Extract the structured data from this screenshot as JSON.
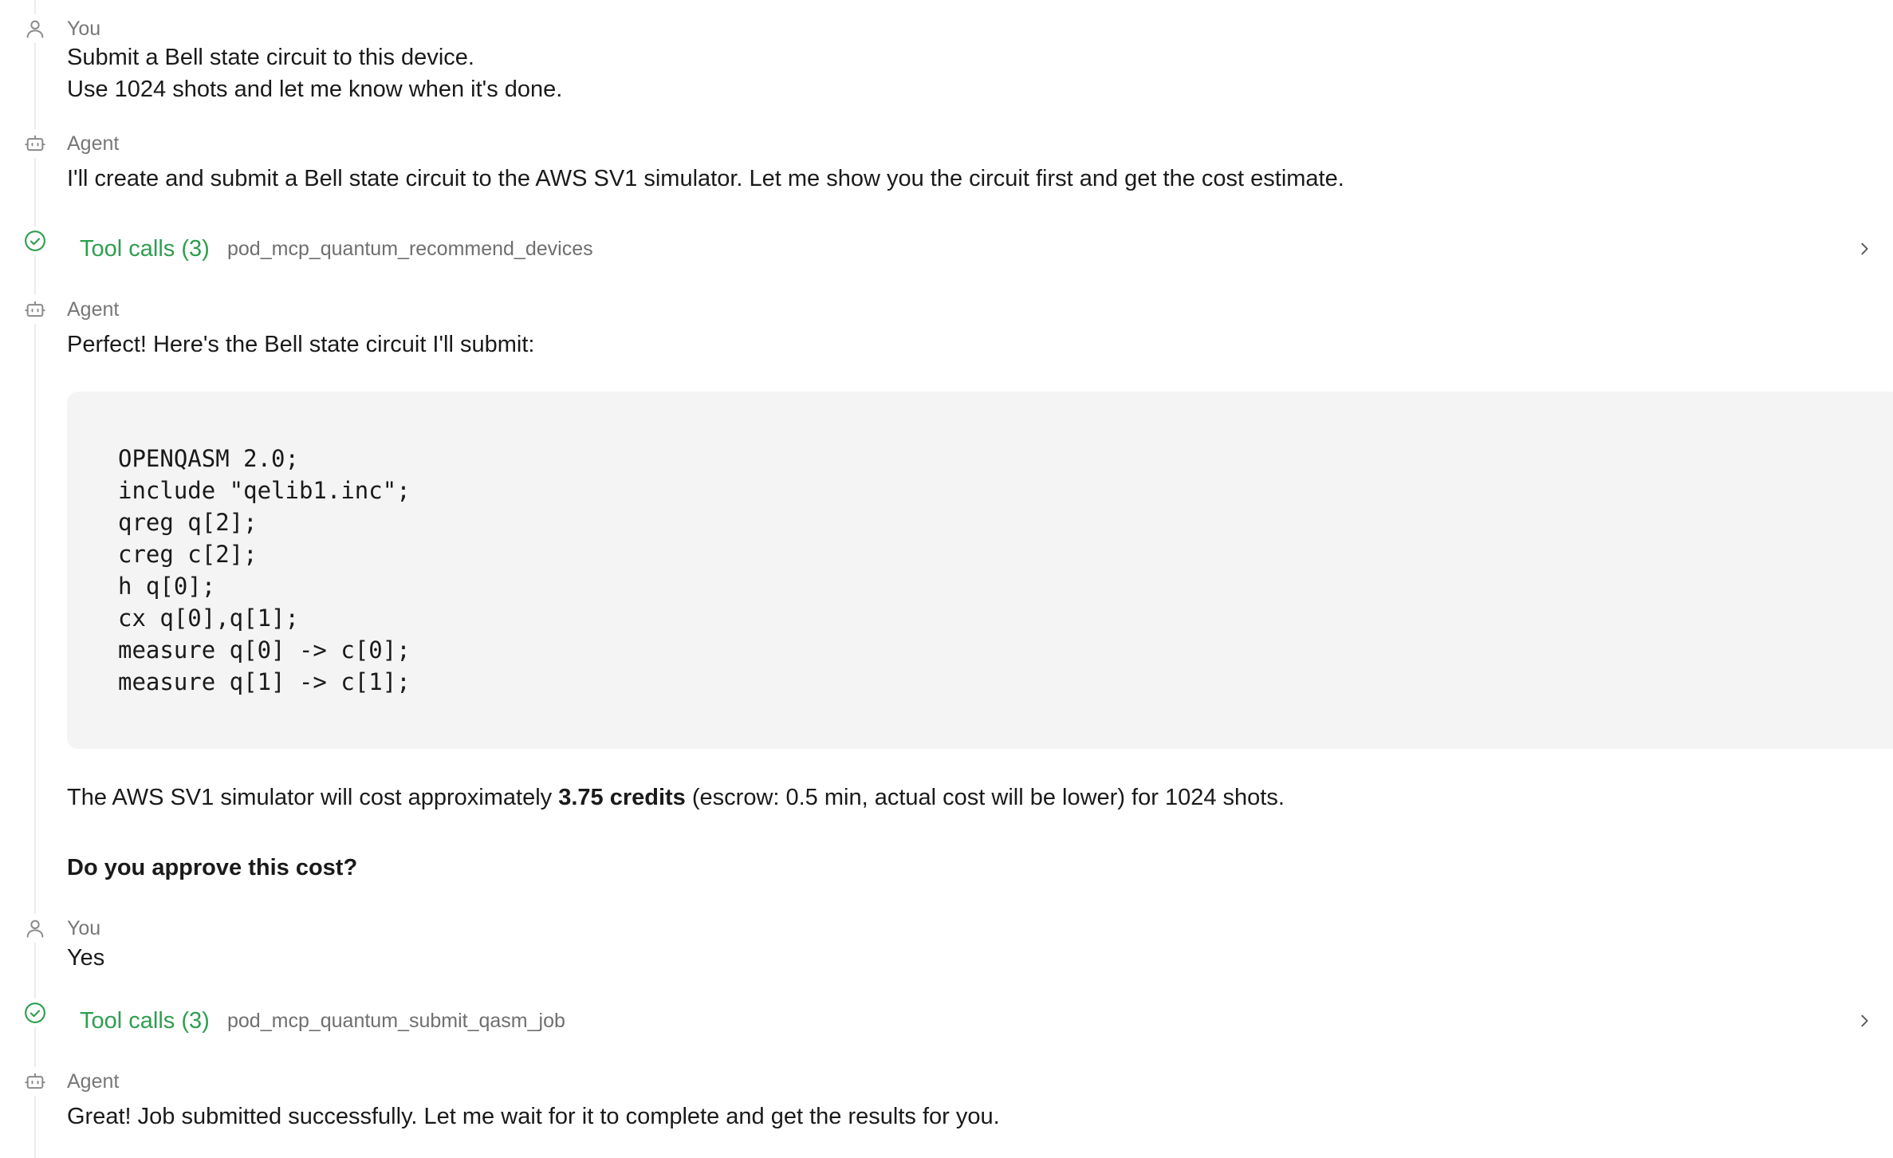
{
  "messages": {
    "m1": {
      "role": "You",
      "line1": "Submit a Bell state circuit to this device.",
      "line2": "Use 1024 shots and let me know when it's done."
    },
    "m2": {
      "role": "Agent",
      "text": "I'll create and submit a Bell state circuit to the AWS SV1 simulator. Let me show you the circuit first and get the cost estimate."
    },
    "tool1": {
      "label": "Tool calls (3)",
      "name": "pod_mcp_quantum_recommend_devices"
    },
    "m3": {
      "role": "Agent",
      "text": "Perfect! Here's the Bell state circuit I'll submit:",
      "code": "OPENQASM 2.0;\ninclude \"qelib1.inc\";\nqreg q[2];\ncreg c[2];\nh q[0];\ncx q[0],q[1];\nmeasure q[0] -> c[0];\nmeasure q[1] -> c[1];",
      "cost_prefix": "The AWS SV1 simulator will cost approximately ",
      "cost_bold": "3.75 credits",
      "cost_suffix": " (escrow: 0.5 min, actual cost will be lower) for 1024 shots.",
      "question": "Do you approve this cost?"
    },
    "m4": {
      "role": "You",
      "text": "Yes"
    },
    "tool2": {
      "label": "Tool calls (3)",
      "name": "pod_mcp_quantum_submit_qasm_job"
    },
    "m5": {
      "role": "Agent",
      "text": "Great! Job submitted successfully. Let me wait for it to complete and get the results for you."
    }
  },
  "colors": {
    "success_green": "#2e9e4f",
    "muted_text": "#777777",
    "code_background": "#f4f4f4"
  },
  "icons": {
    "user": "user-icon",
    "agent": "robot-icon",
    "tool_done": "check-circle-icon",
    "expand": "chevron-right-icon"
  }
}
